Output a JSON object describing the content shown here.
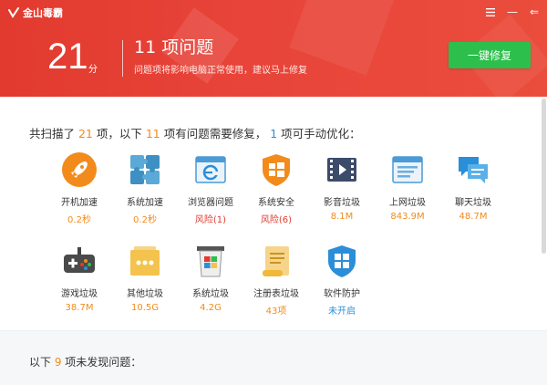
{
  "app": {
    "logo_text": "金山毒霸",
    "colors": {
      "header_red": "#e23a2e",
      "fix_green": "#2dbf4c",
      "accent_orange": "#f28b1b",
      "accent_blue": "#2a8fd8",
      "danger_red": "#e23a2e"
    }
  },
  "window_controls": {
    "menu_icon": "menu-icon",
    "minimize_label": "—",
    "back_label": "⇐"
  },
  "header": {
    "score": "21",
    "score_unit": "分",
    "problem_title": "11 项问题",
    "problem_desc": "问题项将影响电脑正常使用，建议马上修复",
    "fix_button": "一键修复"
  },
  "summary": {
    "prefix": "共扫描了 ",
    "scanned": "21",
    "part2": " 项，以下 ",
    "problems": "11",
    "part3": " 项有问题需要修复， ",
    "manual": "1",
    "part4": " 项可手动优化："
  },
  "items": [
    {
      "name": "开机加速",
      "value": "0.2秒",
      "status": "orange",
      "icon": "rocket-icon"
    },
    {
      "name": "系统加速",
      "value": "0.2秒",
      "status": "orange",
      "icon": "puzzle-icon"
    },
    {
      "name": "浏览器问题",
      "value": "风险(1)",
      "status": "red",
      "icon": "browser-ie-icon"
    },
    {
      "name": "系统安全",
      "value": "风险(6)",
      "status": "red",
      "icon": "shield-windows-icon"
    },
    {
      "name": "影音垃圾",
      "value": "8.1M",
      "status": "orange",
      "icon": "film-icon"
    },
    {
      "name": "上网垃圾",
      "value": "843.9M",
      "status": "orange",
      "icon": "web-page-icon"
    },
    {
      "name": "聊天垃圾",
      "value": "48.7M",
      "status": "orange",
      "icon": "chat-bubbles-icon"
    },
    {
      "name": "游戏垃圾",
      "value": "38.7M",
      "status": "orange",
      "icon": "gamepad-icon"
    },
    {
      "name": "其他垃圾",
      "value": "10.5G",
      "status": "orange",
      "icon": "folder-dots-icon"
    },
    {
      "name": "系统垃圾",
      "value": "4.2G",
      "status": "orange",
      "icon": "windows-bin-icon"
    },
    {
      "name": "注册表垃圾",
      "value": "43项",
      "status": "orange",
      "icon": "scroll-icon"
    },
    {
      "name": "软件防护",
      "value": "未开启",
      "status": "blue",
      "icon": "shield-grid-icon"
    }
  ],
  "bottom": {
    "prefix": "以下 ",
    "count": "9",
    "suffix": " 项未发现问题："
  }
}
